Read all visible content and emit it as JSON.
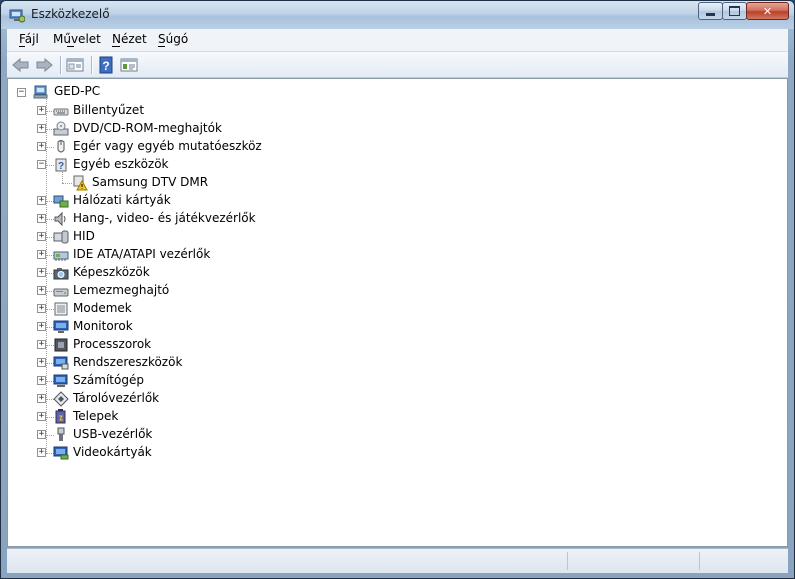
{
  "window": {
    "title": "Eszközkezelő"
  },
  "caption_buttons": {
    "minimize": "▬",
    "maximize": "☐",
    "close": "✕"
  },
  "menu": [
    {
      "key": "F",
      "rest": "ájl"
    },
    {
      "key": "Műv",
      "pre": "Mű",
      "ul": "v",
      "post": "elet"
    },
    {
      "pre": "",
      "ul": "N",
      "post": "ézet"
    },
    {
      "pre": "",
      "ul": "S",
      "post": "úgó"
    }
  ],
  "menu_labels": [
    "Fájl",
    "Művelet",
    "Nézet",
    "Súgó"
  ],
  "toolbar": {
    "back_icon": "arrow-left-icon",
    "forward_icon": "arrow-right-icon",
    "view_icon": "view-icon",
    "help_icon": "help-icon",
    "properties_icon": "properties-icon"
  },
  "tree": {
    "root": "GED-PC",
    "items": [
      {
        "label": "Billentyűzet",
        "icon": "keyboard-icon",
        "expanded": false
      },
      {
        "label": "DVD/CD-ROM-meghajtók",
        "icon": "dvd-icon",
        "expanded": false
      },
      {
        "label": "Egér vagy egyéb mutatóeszköz",
        "icon": "mouse-icon",
        "expanded": false
      },
      {
        "label": "Egyéb eszközök",
        "icon": "unknown-device-icon",
        "expanded": true
      },
      {
        "label": "Hálózati kártyák",
        "icon": "network-icon",
        "expanded": false
      },
      {
        "label": "Hang-, video- és játékvezérlők",
        "icon": "speaker-icon",
        "expanded": false
      },
      {
        "label": "HID",
        "icon": "hid-icon",
        "expanded": false
      },
      {
        "label": "IDE ATA/ATAPI vezérlők",
        "icon": "ide-icon",
        "expanded": false
      },
      {
        "label": "Képeszközök",
        "icon": "camera-icon",
        "expanded": false
      },
      {
        "label": "Lemezmeghajtó",
        "icon": "disk-icon",
        "expanded": false
      },
      {
        "label": "Modemek",
        "icon": "modem-icon",
        "expanded": false
      },
      {
        "label": "Monitorok",
        "icon": "monitor-icon",
        "expanded": false
      },
      {
        "label": "Processzorok",
        "icon": "cpu-icon",
        "expanded": false
      },
      {
        "label": "Rendszereszközök",
        "icon": "system-device-icon",
        "expanded": false
      },
      {
        "label": "Számítógép",
        "icon": "computer-icon",
        "expanded": false
      },
      {
        "label": "Tárolóvezérlők",
        "icon": "storage-icon",
        "expanded": false
      },
      {
        "label": "Telepek",
        "icon": "battery-icon",
        "expanded": false
      },
      {
        "label": "USB-vezérlők",
        "icon": "usb-icon",
        "expanded": false
      },
      {
        "label": "Videokártyák",
        "icon": "display-adapter-icon",
        "expanded": false
      }
    ],
    "child_of_3": {
      "label": "Samsung DTV DMR",
      "icon": "warning-device-icon"
    }
  },
  "colors": {
    "accent": "#316ac5",
    "warning": "#f5c518"
  }
}
